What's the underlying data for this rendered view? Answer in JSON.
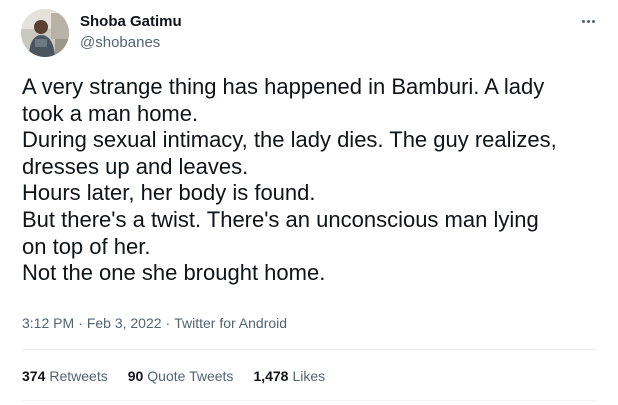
{
  "tweet": {
    "author": {
      "name": "Shoba Gatimu",
      "handle": "@shobanes"
    },
    "lines": [
      "A very strange thing has happened in Bamburi. A lady",
      "took a man home.",
      "During sexual intimacy, the lady dies. The guy realizes,",
      "dresses up and leaves.",
      "Hours later, her body is found.",
      "But there's a twist. There's an unconscious man lying",
      "on top of her.",
      "Not the one she brought home."
    ],
    "meta": {
      "time": "3:12 PM",
      "date": "Feb 3, 2022",
      "source": "Twitter for Android",
      "separator": "·"
    },
    "stats": {
      "retweets_count": "374",
      "retweets_label": "Retweets",
      "quotes_count": "90",
      "quotes_label": "Quote Tweets",
      "likes_count": "1,478",
      "likes_label": "Likes"
    }
  },
  "icons": {
    "more": "more-horizontal-icon"
  },
  "colors": {
    "text_primary": "#0f1419",
    "text_secondary": "#536471",
    "divider": "#eff3f4"
  }
}
